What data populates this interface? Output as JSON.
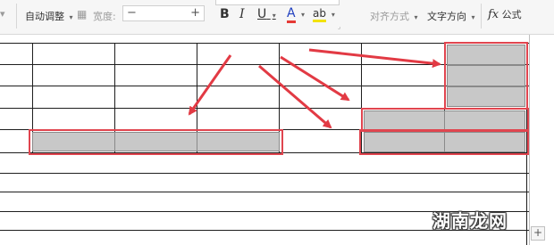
{
  "toolbar": {
    "autofit_label": "自动调整",
    "width_label": "宽度:",
    "minus": "−",
    "plus": "+",
    "bold": "B",
    "italic": "I",
    "underline": "U",
    "font_color": "A",
    "highlight": "ab",
    "align_label": "对齐方式",
    "text_direction_label": "文字方向",
    "fx": "fx",
    "formula_label": "公式"
  },
  "sheet": {
    "add_button": "+"
  },
  "watermark": "湖南龙网",
  "colors": {
    "selection_border": "#e0454f",
    "arrow": "#e23a44",
    "merged_fill": "#c8c8c8"
  }
}
